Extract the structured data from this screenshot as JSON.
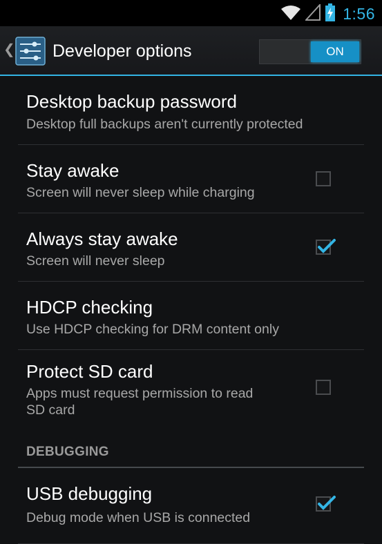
{
  "status_bar": {
    "time": "1:56",
    "icons": [
      "wifi-icon",
      "signal-icon",
      "battery-charging-icon"
    ],
    "accent_color": "#33b5e5"
  },
  "action_bar": {
    "back_glyph": "❮",
    "app_icon": "settings-sliders-icon",
    "title": "Developer options",
    "toggle_label": "ON",
    "toggle_state": true
  },
  "preferences": [
    {
      "title": "Desktop backup password",
      "summary": "Desktop full backups aren't currently protected",
      "has_checkbox": false
    },
    {
      "title": "Stay awake",
      "summary": "Screen will never sleep while charging",
      "has_checkbox": true,
      "checked": false
    },
    {
      "title": "Always stay awake",
      "summary": "Screen will never sleep",
      "has_checkbox": true,
      "checked": true
    },
    {
      "title": "HDCP checking",
      "summary": "Use HDCP checking for DRM content only",
      "has_checkbox": false
    },
    {
      "title": "Protect SD card",
      "summary_line1": "Apps must request permission to read",
      "summary_line2": "SD card",
      "has_checkbox": true,
      "checked": false
    }
  ],
  "category": {
    "label": "DEBUGGING"
  },
  "debug_preferences": [
    {
      "title": "USB debugging",
      "summary": "Debug mode when USB is connected",
      "has_checkbox": true,
      "checked": true
    }
  ],
  "colors": {
    "background": "#111214",
    "accent": "#33b5e5",
    "summary_text": "#a8a8a8",
    "divider": "#2e3033"
  }
}
